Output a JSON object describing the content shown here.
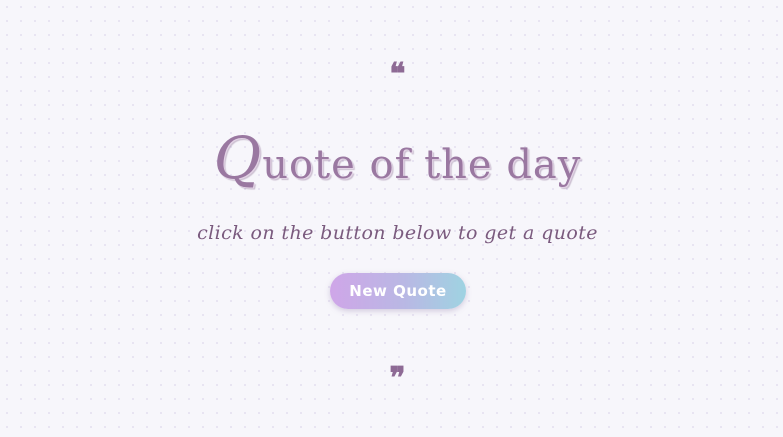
{
  "quote": {
    "open_mark": "❝",
    "close_mark": "❞"
  },
  "title": {
    "cap": "Q",
    "rest": "uote of the day"
  },
  "subtitle": "click on the button below to get a quote",
  "button": {
    "label": "New Quote"
  },
  "colors": {
    "background": "#f7f6fb",
    "title": "#9a78a1",
    "quote_mark": "#8e6a95",
    "button_gradient_start": "#cfa6e8",
    "button_gradient_end": "#9fd3e2"
  }
}
